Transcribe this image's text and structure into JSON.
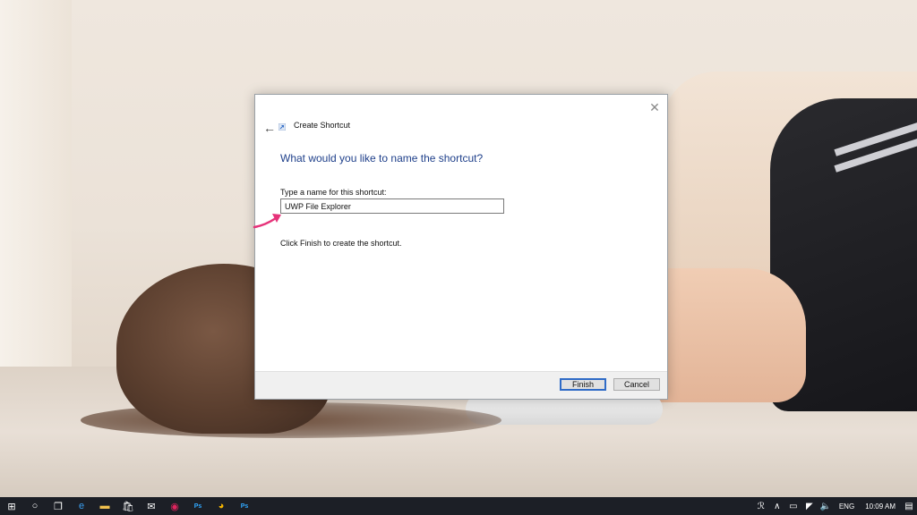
{
  "window": {
    "title": "Create Shortcut",
    "close_symbol": "✕",
    "back_symbol": "←"
  },
  "page": {
    "heading": "What would you like to name the shortcut?",
    "name_label": "Type a name for this shortcut:",
    "name_value": "UWP File Explorer",
    "hint": "Click Finish to create the shortcut."
  },
  "buttons": {
    "finish": "Finish",
    "cancel": "Cancel"
  },
  "taskbar": {
    "apps": [
      {
        "name": "start-icon",
        "symbol": "⊞",
        "color": "#ffffff"
      },
      {
        "name": "cortana-icon",
        "symbol": "○",
        "color": "#ffffff"
      },
      {
        "name": "task-view-icon",
        "symbol": "❐",
        "color": "#ffffff"
      },
      {
        "name": "edge-icon",
        "symbol": "e",
        "color": "#3aa0f3"
      },
      {
        "name": "file-explorer-icon",
        "symbol": "▬",
        "color": "#f2c14e"
      },
      {
        "name": "store-icon",
        "symbol": "🛍",
        "color": "#ffffff"
      },
      {
        "name": "mail-icon",
        "symbol": "✉",
        "color": "#ffffff"
      },
      {
        "name": "app-red-icon",
        "symbol": "◉",
        "color": "#e0245e"
      },
      {
        "name": "photoshop-icon",
        "symbol": "Ps",
        "color": "#31a8ff"
      },
      {
        "name": "chrome-icon",
        "symbol": "◕",
        "color": "#f4b400"
      },
      {
        "name": "photoshop-icon-2",
        "symbol": "Ps",
        "color": "#31a8ff"
      }
    ],
    "tray": {
      "people_symbol": "ℛ",
      "chevron_symbol": "∧",
      "battery_symbol": "▭",
      "network_symbol": "◤",
      "volume_symbol": "🔈",
      "language": "ENG",
      "clock": "10:09 AM",
      "notifications_symbol": "▤"
    }
  },
  "colors": {
    "heading": "#1e3f8a",
    "accent": "#2f6bc7",
    "annotation": "#e6337a"
  }
}
